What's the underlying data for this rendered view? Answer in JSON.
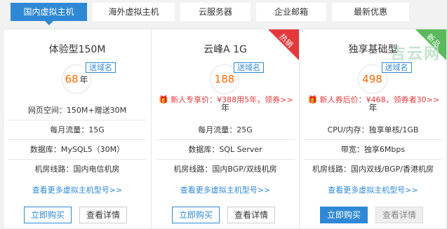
{
  "tabs": [
    {
      "label": "国内虚拟主机",
      "active": true
    },
    {
      "label": "海外虚拟主机",
      "active": false
    },
    {
      "label": "云服务器",
      "active": false
    },
    {
      "label": "企业邮箱",
      "active": false
    },
    {
      "label": "最新优惠",
      "active": false
    }
  ],
  "cards": [
    {
      "title": "体验型150M",
      "price": "68",
      "unit": "年",
      "badge": "送域名",
      "specs": [
        "网页空间：150M+赠送30M",
        "每月流量：15G",
        "数据库：MySQL5（30M）",
        "机房线路：国内电信机房"
      ],
      "more": "查看更多虚拟主机型号>>",
      "buy": "立即购买",
      "detail": "查看详情"
    },
    {
      "title": "云峰A 1G",
      "price": "188",
      "unit": "年",
      "badge": "送域名",
      "ribbon": "热销",
      "promo": "新人专享价：¥388用5年，领券>>",
      "specs": [
        "每月流量：25G",
        "数据库：SQL Server",
        "机房线路：国内BGP/双线机房"
      ],
      "more": "查看更多虚拟主机型号>>",
      "buy": "立即购买",
      "detail": "查看详情"
    },
    {
      "title": "独享基础型",
      "price": "498",
      "unit": "年",
      "badge": "送域名",
      "ribbon": "新品",
      "promo": "新人券后价：¥468，领券者30>>",
      "specs": [
        "CPU/内存：独享单核/1GB",
        "带宽：独享6Mbps",
        "机房线路：国内双线/BGP/香港机房"
      ],
      "more": "查看更多虚拟主机型号>>",
      "buy": "立即购买",
      "detail": "查看详情"
    }
  ],
  "watermark": "吉云网",
  "colors": {
    "accent": "#2f88d6",
    "price": "#ff6a00",
    "hot": "#e4393c",
    "new": "#5cb85c"
  }
}
